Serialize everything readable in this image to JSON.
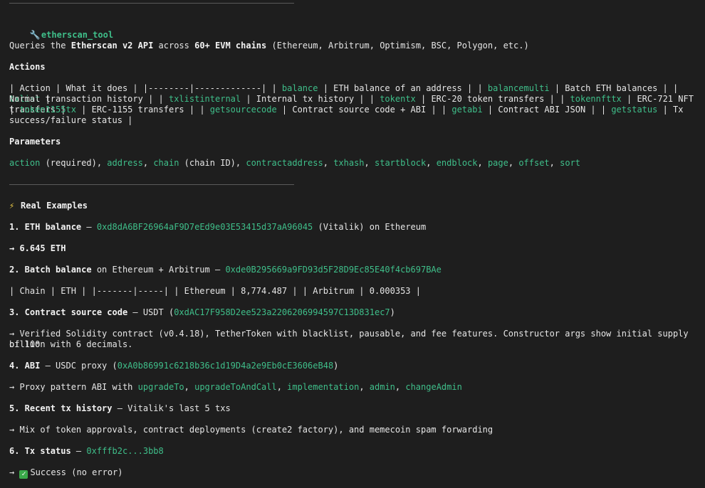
{
  "title_icon": "wrench-icon",
  "tool_name": "etherscan_tool",
  "intro": {
    "pre": "Queries the ",
    "bold1": "Etherscan v2 API",
    "mid": " across ",
    "bold2": "60+ EVM chains",
    "post": " (Ethereum, Arbitrum, Optimism, BSC, Polygon, etc.)"
  },
  "actions_heading": "Actions",
  "actions_table": {
    "t1": "| Action | What it does | |--------|-------------| | ",
    "a1": "balance",
    "t2": " | ETH balance of an address | | ",
    "a2": "balancemulti",
    "t3": " | Batch ETH balances | | ",
    "a3": "txlist",
    "t4": " |",
    "t5": "Normal transaction history | | ",
    "a4": "txlistinternal",
    "t6": " | Internal tx history | | ",
    "a5": "tokentx",
    "t7": " | ERC-20 token transfers | | ",
    "a6": "tokennfttx",
    "t8": " | ERC-721 NFT transfers |",
    "t9": "| ",
    "a7": "token1155tx",
    "t10": " | ERC-1155 transfers | | ",
    "a8": "getsourcecode",
    "t11": " | Contract source code + ABI | | ",
    "a9": "getabi",
    "t12": " | Contract ABI JSON | | ",
    "a10": "getstatus",
    "t13": " | Tx",
    "t14": "success/failure status |"
  },
  "params_heading": "Parameters",
  "params": {
    "p1": "action",
    "s1": " (required), ",
    "p2": "address",
    "s2": ", ",
    "p3": "chain",
    "s3": " (chain ID), ",
    "p4": "contractaddress",
    "s4": ", ",
    "p5": "txhash",
    "s5": ", ",
    "p6": "startblock",
    "s6": ", ",
    "p7": "endblock",
    "s7": ", ",
    "p8": "page",
    "s8": ", ",
    "p9": "offset",
    "s9": ", ",
    "p10": "sort"
  },
  "examples_icon": "lightning-icon",
  "examples_heading": "Real Examples",
  "ex1": {
    "label": "1. ETH balance",
    "dash": " — ",
    "addr": "0xd8dA6BF26964aF9D7eEd9e03E53415d37aA96045",
    "post": " (Vitalik) on Ethereum",
    "result": "→ 6.645 ETH"
  },
  "ex2": {
    "label": "2. Batch balance",
    "mid": " on Ethereum + Arbitrum — ",
    "addr": "0xde0B295669a9FD93d5F28D9Ec85E40f4cb697BAe",
    "table": "| Chain | ETH | |-------|-----| | Ethereum | 8,774.487 | | Arbitrum | 0.000353 |"
  },
  "ex3": {
    "label": "3. Contract source code",
    "mid": " — USDT (",
    "addr": "0xdAC17F958D2ee523a2206206994597C13D831ec7",
    "post": ")",
    "result1": "→ Verified Solidity contract (v0.4.18), TetherToken with blacklist, pausable, and fee features. Constructor args show initial supply of 100",
    "result2": "billion with 6 decimals."
  },
  "ex4": {
    "label": "4. ABI",
    "mid": " — USDC proxy (",
    "addr": "0xA0b86991c6218b36c1d19D4a2e9Eb0cE3606eB48",
    "post": ")",
    "r_pre": "→ Proxy pattern ABI with ",
    "f1": "upgradeTo",
    "c1": ", ",
    "f2": "upgradeToAndCall",
    "c2": ", ",
    "f3": "implementation",
    "c3": ", ",
    "f4": "admin",
    "c4": ", ",
    "f5": "changeAdmin"
  },
  "ex5": {
    "label": "5. Recent tx history",
    "mid": " — Vitalik's last 5 txs",
    "result": "→ Mix of token approvals, contract deployments (create2 factory), and memecoin spam forwarding"
  },
  "ex6": {
    "label": "6. Tx status",
    "dash": " — ",
    "hash": "0xfffb2c...3bb8",
    "r_pre": "→ ",
    "check_icon": "check-mark-icon",
    "result": "Success (no error)"
  }
}
